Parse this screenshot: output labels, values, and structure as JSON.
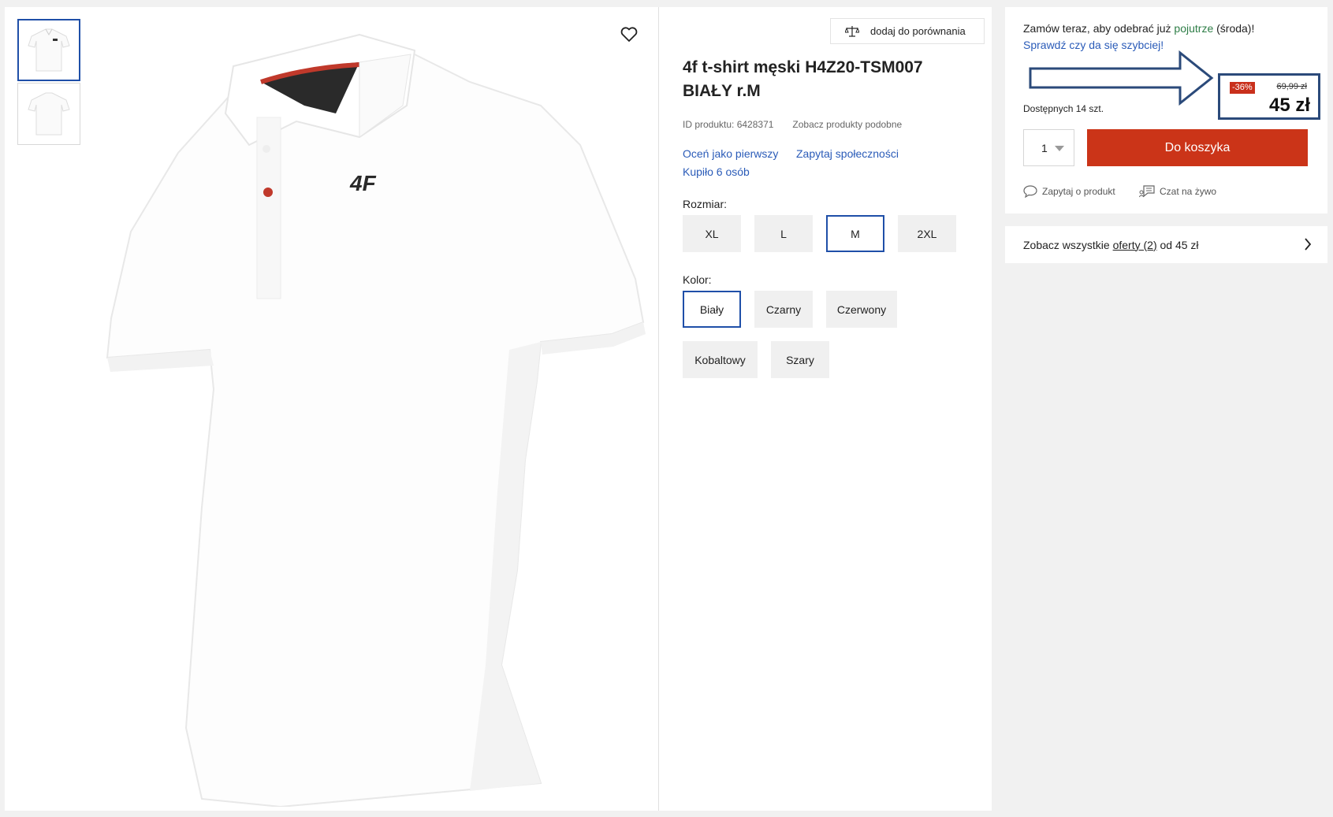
{
  "gallery": {
    "thumbnails": [
      "thumb-front",
      "thumb-back"
    ]
  },
  "compare": {
    "label": "dodaj do porównania"
  },
  "product": {
    "title": "4f t-shirt męski H4Z20-TSM007 BIAŁY r.M",
    "id_text": "ID produktu: 6428371",
    "similar_link": "Zobacz produkty podobne",
    "rate_link": "Oceń jako pierwszy",
    "ask_community": "Zapytaj społeczności",
    "bought": "Kupiło 6 osób",
    "size_label": "Rozmiar:",
    "sizes": [
      "XL",
      "L",
      "M",
      "2XL"
    ],
    "selected_size": "M",
    "color_label": "Kolor:",
    "colors": [
      "Biały",
      "Czarny",
      "Czerwony",
      "Kobaltowy",
      "Szary"
    ],
    "selected_color": "Biały"
  },
  "buybox": {
    "delivery_prefix": "Zamów teraz, aby odebrać już ",
    "delivery_day": "pojutrze",
    "delivery_suffix": " (środa)!",
    "check_faster": "Sprawdź czy da się szybciej!",
    "discount": "-36%",
    "old_price": "69,99 zł",
    "new_price": "45 zł",
    "availability": "Dostępnych 14 szt.",
    "quantity": "1",
    "cart_button": "Do koszyka",
    "ask_product": "Zapytaj o produkt",
    "chat_live": "Czat na żywo"
  },
  "offers": {
    "prefix": "Zobacz wszystkie ",
    "link": "oferty (2)",
    "suffix": " od 45 zł"
  },
  "colors": {
    "accent_blue": "#1f4fa8",
    "cart_red": "#cb3418",
    "link_blue": "#2a5bb8",
    "annotation_navy": "#2b4a7a",
    "delivery_green": "#2d7d46"
  }
}
